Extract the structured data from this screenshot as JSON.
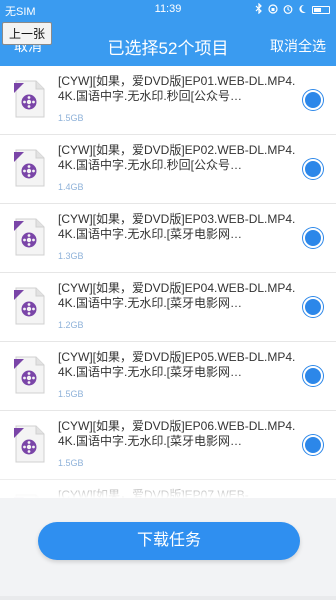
{
  "status_bar": {
    "carrier": "无SIM",
    "time": "11:39"
  },
  "nav": {
    "cancel_label": "取消",
    "back_tooltip": "上一张",
    "title": "已选择52个项目",
    "deselect_all_label": "取消全选"
  },
  "files": [
    {
      "name": "[CYW][如果，爱DVD版]EP01.WEB-DL.MP4.4K.国语中字.无水印.秒回[公众号…",
      "size": "1.5GB"
    },
    {
      "name": "[CYW][如果，爱DVD版]EP02.WEB-DL.MP4.4K.国语中字.无水印.秒回[公众号…",
      "size": "1.4GB"
    },
    {
      "name": "[CYW][如果，爱DVD版]EP03.WEB-DL.MP4.4K.国语中字.无水印.[菜牙电影网…",
      "size": "1.3GB"
    },
    {
      "name": "[CYW][如果，爱DVD版]EP04.WEB-DL.MP4.4K.国语中字.无水印.[菜牙电影网…",
      "size": "1.2GB"
    },
    {
      "name": "[CYW][如果，爱DVD版]EP05.WEB-DL.MP4.4K.国语中字.无水印.[菜牙电影网…",
      "size": "1.5GB"
    },
    {
      "name": "[CYW][如果，爱DVD版]EP06.WEB-DL.MP4.4K.国语中字.无水印.[菜牙电影网…",
      "size": "1.5GB"
    },
    {
      "name": "[CYW][如果，爱DVD版]EP07.WEB-",
      "size": ""
    }
  ],
  "download_button_label": "下载任务",
  "colors": {
    "accent": "#3a9bf0",
    "check": "#2c87e9",
    "size_text": "#8fb2d9"
  }
}
